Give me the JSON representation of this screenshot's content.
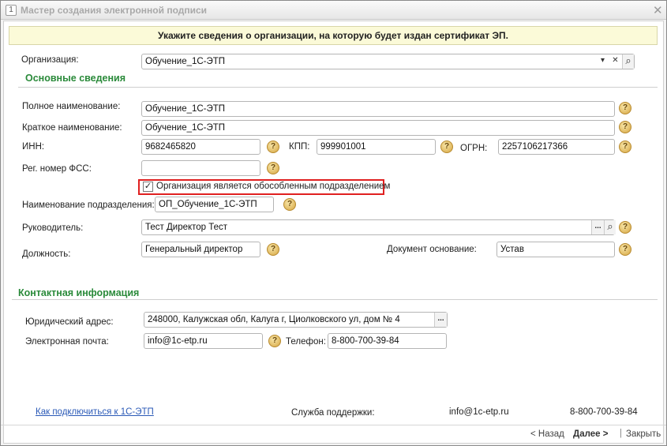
{
  "window": {
    "title": "Мастер создания электронной подписи",
    "close_glyph": "✕"
  },
  "banner": "Укажите сведения о организации, на которую будет издан сертификат ЭП.",
  "organization": {
    "label": "Организация:",
    "value": "Обучение_1С-ЭТП"
  },
  "basic": {
    "section_title": "Основные сведения",
    "full_name_label": "Полное наименование:",
    "full_name_value": "Обучение_1С-ЭТП",
    "short_name_label": "Краткое наименование:",
    "short_name_value": "Обучение_1С-ЭТП",
    "inn_label": "ИНН:",
    "inn_value": "9682465820",
    "kpp_label": "КПП:",
    "kpp_value": "999901001",
    "ogrn_label": "ОГРН:",
    "ogrn_value": "2257106217366",
    "fss_label": "Рег. номер ФСС:",
    "fss_value": "",
    "separate_unit_label": "Организация является обособленным подразделением",
    "separate_unit_checked": true,
    "unit_name_label": "Наименование подразделения:",
    "unit_name_value": "ОП_Обучение_1С-ЭТП",
    "head_label": "Руководитель:",
    "head_value": "Тест Директор Тест",
    "position_label": "Должность:",
    "position_value": "Генеральный директор",
    "basis_label": "Документ основание:",
    "basis_value": "Устав"
  },
  "contact": {
    "section_title": "Контактная информация",
    "legal_address_label": "Юридический адрес:",
    "legal_address_value": "248000, Калужская обл, Калуга г, Циолковского ул, дом № 4",
    "email_label": "Электронная почта:",
    "email_value": "info@1c-etp.ru",
    "phone_label": "Телефон:",
    "phone_value": "8-800-700-39-84"
  },
  "support": {
    "connect_link": "Как подключиться к 1С-ЭТП",
    "service_label": "Служба поддержки:",
    "email": "info@1c-etp.ru",
    "phone": "8-800-700-39-84"
  },
  "nav": {
    "back": "< Назад",
    "next": "Далее >",
    "close": "Закрыть"
  },
  "icons": {
    "help_glyph": "?",
    "dropdown_glyph": "▾",
    "clear_glyph": "✕",
    "search_glyph": "⌕",
    "ellipsis_glyph": "...",
    "check_glyph": "✓"
  }
}
